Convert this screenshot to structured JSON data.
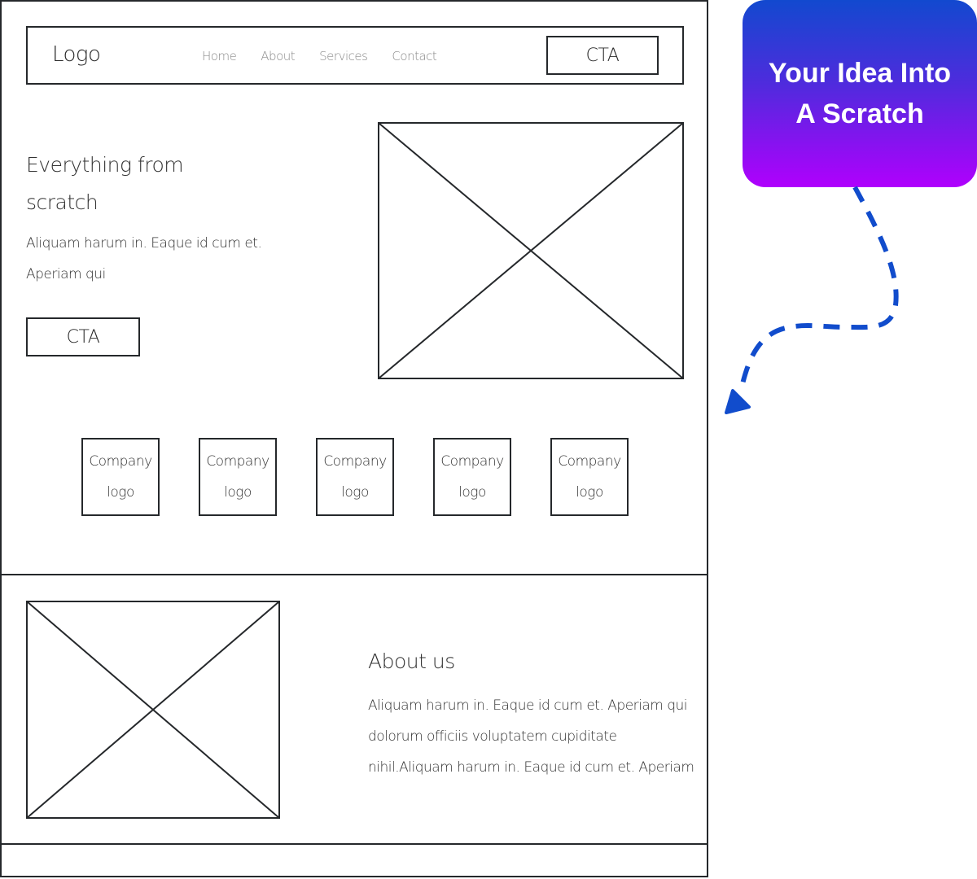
{
  "wireframe": {
    "nav": {
      "logo": "Logo",
      "links": [
        "Home",
        "About",
        "Services",
        "Contact"
      ],
      "cta": "CTA"
    },
    "hero": {
      "title_line1": "Everything from",
      "title_line2": "scratch",
      "text_line1": "Aliquam harum in. Eaque id cum et.",
      "text_line2": "Aperiam qui",
      "cta": "CTA",
      "image_icon": "image-placeholder-icon"
    },
    "company_logos": [
      {
        "line1": "Company",
        "line2": "logo"
      },
      {
        "line1": "Company",
        "line2": "logo"
      },
      {
        "line1": "Company",
        "line2": "logo"
      },
      {
        "line1": "Company",
        "line2": "logo"
      },
      {
        "line1": "Company",
        "line2": "logo"
      }
    ],
    "about": {
      "title": "About us",
      "text_line1": "Aliquam harum in. Eaque id cum et. Aperiam qui",
      "text_line2": "dolorum officiis voluptatem cupiditate",
      "text_line3": "nihil.Aliquam harum in. Eaque id cum et. Aperiam",
      "image_icon": "image-placeholder-icon"
    }
  },
  "callout": {
    "line1": "Your Idea Into",
    "line2": "A Scratch",
    "gradient_top": "#1249cf",
    "gradient_bottom": "#b000fd"
  },
  "arrow": {
    "color": "#114ccc",
    "style": "dashed"
  }
}
